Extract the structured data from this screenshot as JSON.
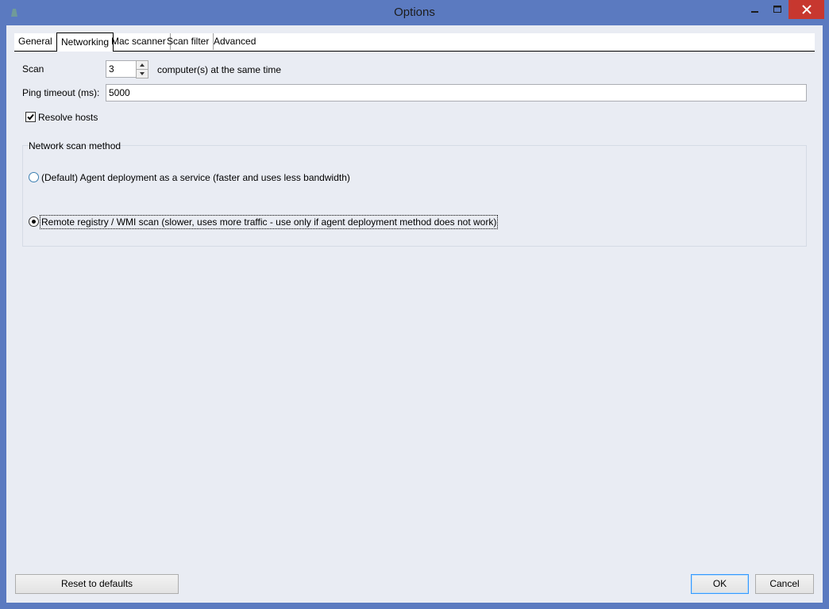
{
  "window": {
    "title": "Options"
  },
  "tabs": [
    {
      "label": "General"
    },
    {
      "label": "Networking"
    },
    {
      "label": "Mac scanner"
    },
    {
      "label": "Scan filter"
    },
    {
      "label": "Advanced"
    }
  ],
  "networking": {
    "scan_label": "Scan",
    "scan_value": "3",
    "scan_suffix": "computer(s) at the same time",
    "ping_timeout_label": "Ping timeout (ms):",
    "ping_timeout_value": "5000",
    "resolve_hosts_label": "Resolve hosts",
    "resolve_hosts_checked": true,
    "scan_method_group_label": "Network scan method",
    "methods": [
      {
        "label": "(Default) Agent deployment as a service (faster and uses less bandwidth)",
        "checked": false
      },
      {
        "label": "Remote registry / WMI scan (slower, uses more traffic - use only if agent deployment method does not work)",
        "checked": true
      }
    ]
  },
  "buttons": {
    "reset": "Reset to defaults",
    "ok": "OK",
    "cancel": "Cancel"
  },
  "colors": {
    "titlebar": "#5b7ac0",
    "client": "#e9ecf3",
    "close": "#c7372f",
    "focus_border": "#3399ff"
  },
  "icons": {
    "app": "app-icon",
    "minimize": "minimize-icon",
    "maximize": "maximize-icon",
    "close": "close-icon"
  }
}
